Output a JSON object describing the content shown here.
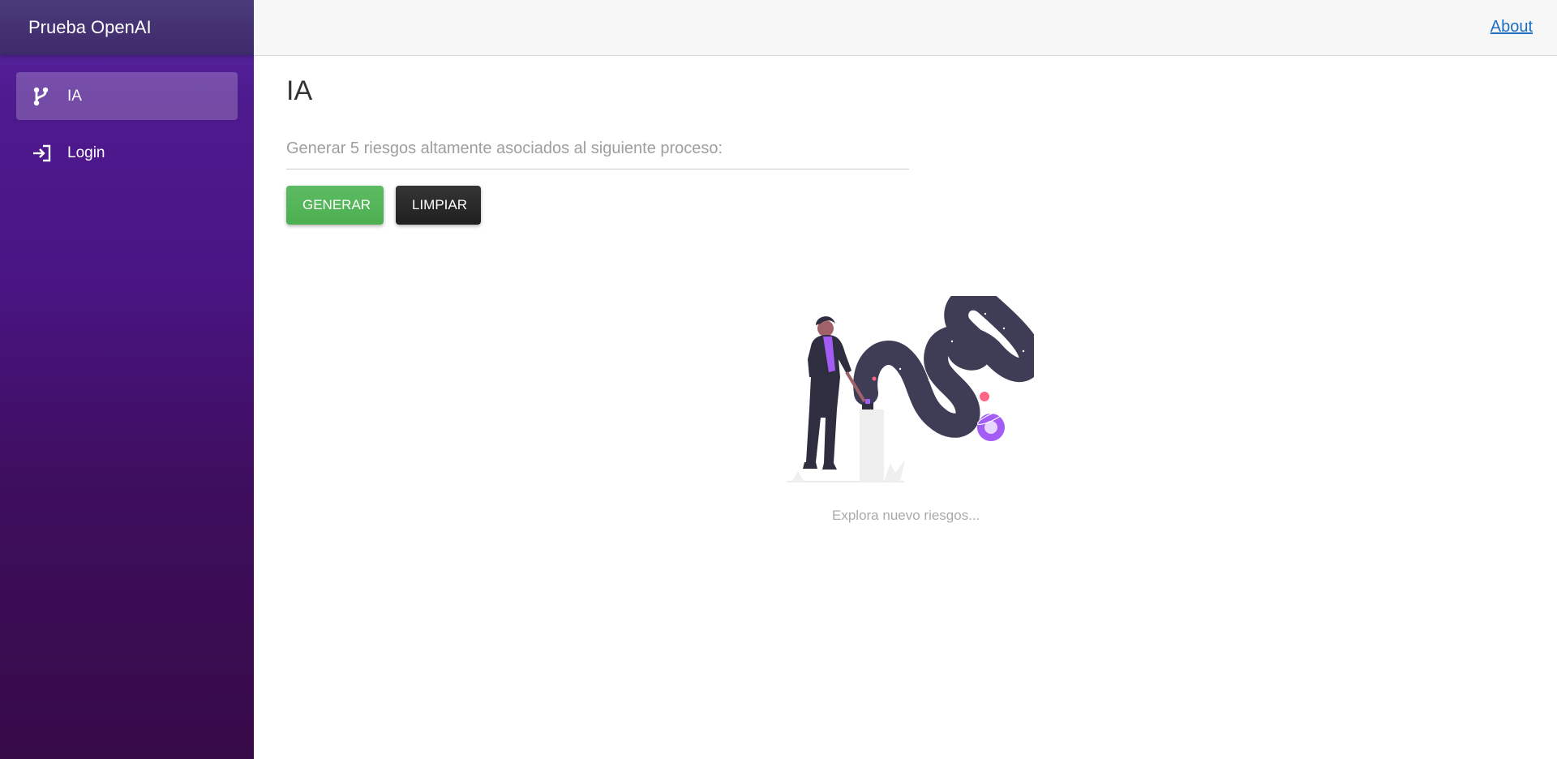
{
  "app": {
    "title": "Prueba OpenAI"
  },
  "sidebar": {
    "items": [
      {
        "label": "IA",
        "icon": "branch-icon",
        "active": true
      },
      {
        "label": "Login",
        "icon": "login-icon",
        "active": false
      }
    ]
  },
  "header": {
    "about_label": "About"
  },
  "main": {
    "title": "IA",
    "prompt_placeholder": "Generar 5 riesgos altamente asociados al siguiente proceso:",
    "prompt_value": "",
    "generate_label": "GENERAR",
    "clear_label": "LIMPIAR",
    "empty_state_text": "Explora nuevo riesgos..."
  },
  "colors": {
    "sidebar_top": "#5b2aa8",
    "sidebar_bottom": "#370a48",
    "generate_button": "#4caf50",
    "clear_button": "#212121",
    "link": "#1b6ec2",
    "accent_purple": "#a35cf6"
  }
}
